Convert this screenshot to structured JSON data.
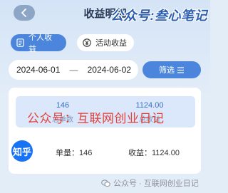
{
  "header": {
    "title": "收益明细",
    "back_icon": "chevron-left-icon"
  },
  "watermark_top": "公众号:叁心笔记",
  "tabs": [
    {
      "label": "个人收益",
      "icon": "document-icon",
      "active": true
    },
    {
      "label": "活动收益",
      "icon": "yen-icon",
      "active": false
    }
  ],
  "date_range": {
    "start": "2024-06-01",
    "separator": "—",
    "end": "2024-06-02"
  },
  "filter": {
    "label": "筛选",
    "icon": "menu-lines-icon"
  },
  "summary": {
    "count_value": "146",
    "count_label": "总单数",
    "income_value": "1124.00",
    "income_label": "总收益"
  },
  "watermark_middle": "公众号：互联网创业日记",
  "records": [
    {
      "platform_logo": "知乎",
      "count_text": "单量：146",
      "income_text": "收益：1124.00"
    }
  ],
  "watermark_bottom": "公众号 · 互联网创业日记",
  "colors": {
    "accent": "#4b86dc",
    "background": "#e3edf8",
    "summary_bg": "#dbe8fb",
    "watermark_red": "#e2413a"
  }
}
